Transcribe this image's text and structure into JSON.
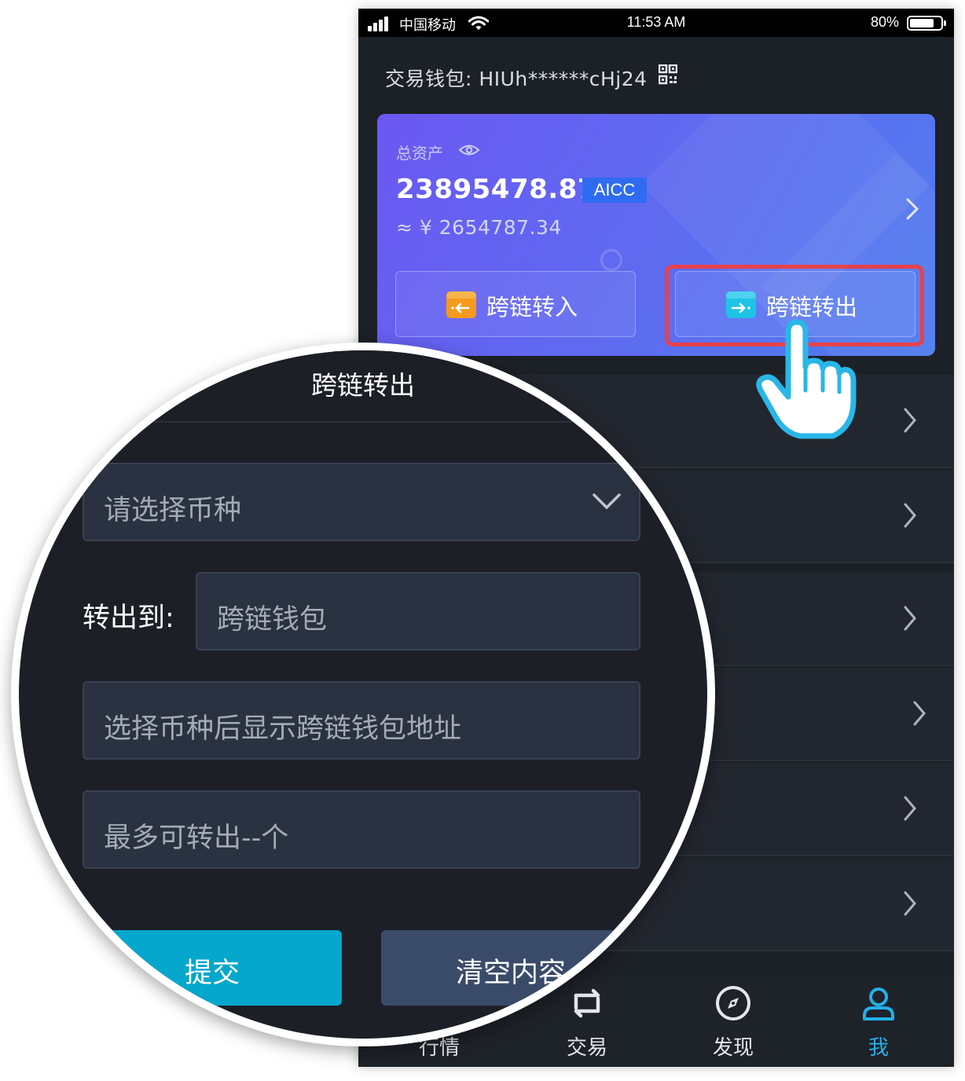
{
  "status_bar": {
    "carrier": "中国移动",
    "time": "11:53 AM",
    "battery_text": "80%",
    "battery_level": 0.8
  },
  "wallet": {
    "label": "交易钱包:",
    "address": "HIUh******cHj24",
    "qr_icon": "qr-code-icon"
  },
  "assets": {
    "label": "总资产",
    "eye_icon": "eye-icon",
    "total": "23895478.87",
    "currency_badge": "AICC",
    "cny_value": "≈ ¥ 2654787.34",
    "colors": {
      "card_start": "#6b58f2",
      "card_end": "#4f7cef",
      "badge": "#2f6bf2"
    }
  },
  "actions": {
    "cross_in": {
      "label": "跨链转入",
      "icon": "transfer-in-icon",
      "color": "#f59a1c"
    },
    "cross_out": {
      "label": "跨链转出",
      "icon": "transfer-out-icon",
      "color": "#1fc3e6"
    },
    "highlight_color": "#e8414b"
  },
  "tabbar": {
    "items": [
      {
        "label": "行情",
        "icon": "market-icon",
        "active": false
      },
      {
        "label": "交易",
        "icon": "trade-icon",
        "active": false
      },
      {
        "label": "发现",
        "icon": "compass-icon",
        "active": false
      },
      {
        "label": "我",
        "icon": "user-icon",
        "active": true
      }
    ],
    "active_color": "#23b0e6"
  },
  "zoom_panel": {
    "title": "跨链转出",
    "select_placeholder": "请选择币种",
    "transfer_to_label": "转出到:",
    "target_placeholder": "跨链钱包",
    "address_placeholder": "选择币种后显示跨链钱包地址",
    "max_placeholder": "最多可转出--个",
    "submit_label": "提交",
    "clear_label": "清空内容",
    "colors": {
      "submit": "#05a7cd",
      "clear": "#3a4b6a"
    }
  }
}
